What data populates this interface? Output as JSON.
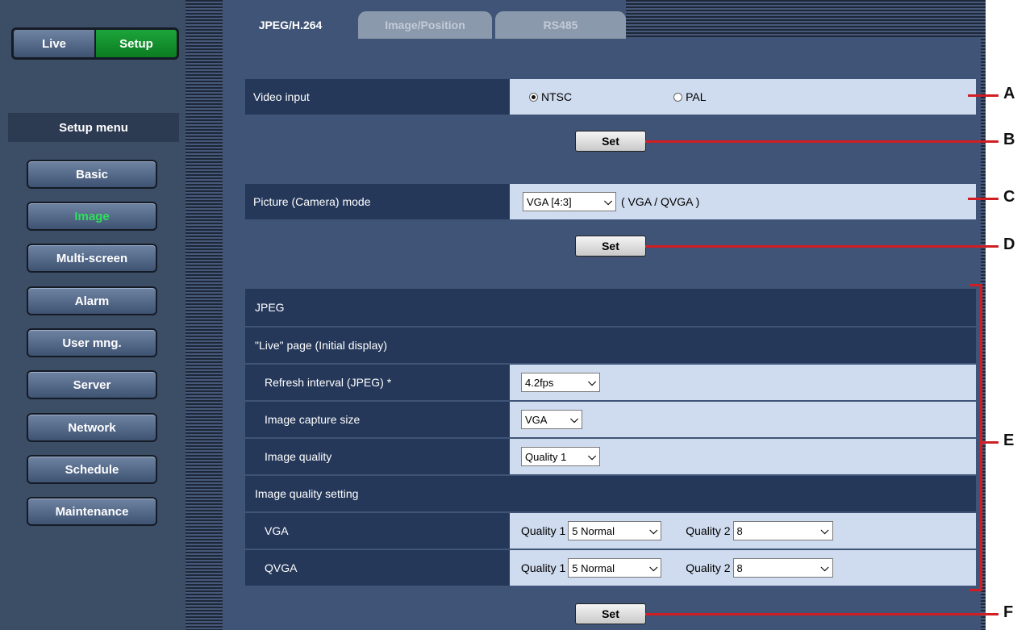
{
  "nav": {
    "live": "Live",
    "setup": "Setup"
  },
  "menu": {
    "title": "Setup menu",
    "items": [
      "Basic",
      "Image",
      "Multi-screen",
      "Alarm",
      "User mng.",
      "Server",
      "Network",
      "Schedule",
      "Maintenance"
    ],
    "active": "Image"
  },
  "tabs": [
    "JPEG/H.264",
    "Image/Position",
    "RS485"
  ],
  "video_input": {
    "label": "Video input",
    "options": [
      "NTSC",
      "PAL"
    ],
    "selected": "NTSC"
  },
  "set_label": "Set",
  "picture_mode": {
    "label": "Picture (Camera) mode",
    "value": "VGA [4:3]",
    "note": "( VGA / QVGA )"
  },
  "jpeg": {
    "header": "JPEG",
    "live_header": "\"Live\" page (Initial display)",
    "refresh": {
      "label": "Refresh interval (JPEG) *",
      "value": "4.2fps"
    },
    "capture": {
      "label": "Image capture size",
      "value": "VGA"
    },
    "quality": {
      "label": "Image quality",
      "value": "Quality 1"
    },
    "quality_setting_header": "Image quality setting",
    "vga": {
      "label": "VGA",
      "q1_label": "Quality 1",
      "q1": "5 Normal",
      "q2_label": "Quality 2",
      "q2": "8"
    },
    "qvga": {
      "label": "QVGA",
      "q1_label": "Quality 1",
      "q1": "5 Normal",
      "q2_label": "Quality 2",
      "q2": "8"
    }
  },
  "callouts": [
    "A",
    "B",
    "C",
    "D",
    "E",
    "F"
  ],
  "colors": {
    "accent": "#d01e24",
    "active_green": "#2ee05a",
    "setup_green": "#1da53a"
  }
}
